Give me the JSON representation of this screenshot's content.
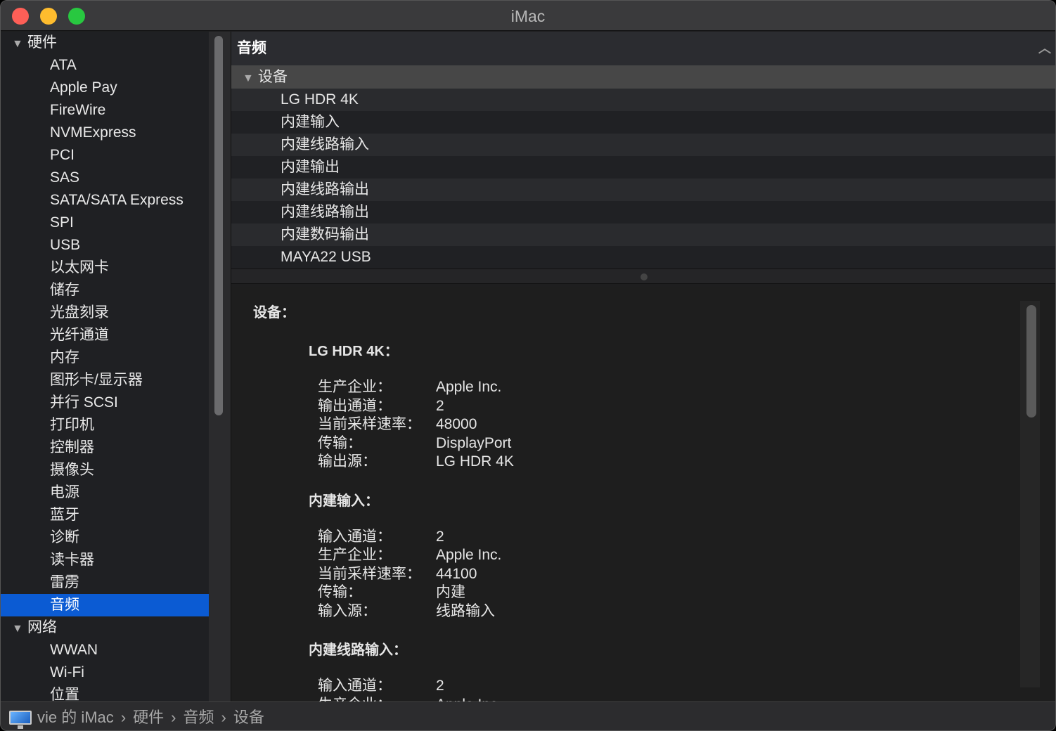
{
  "window": {
    "title": "iMac"
  },
  "sidebar": {
    "groups": [
      {
        "label": "硬件",
        "items": [
          "ATA",
          "Apple Pay",
          "FireWire",
          "NVMExpress",
          "PCI",
          "SAS",
          "SATA/SATA Express",
          "SPI",
          "USB",
          "以太网卡",
          "储存",
          "光盘刻录",
          "光纤通道",
          "内存",
          "图形卡/显示器",
          "并行 SCSI",
          "打印机",
          "控制器",
          "摄像头",
          "电源",
          "蓝牙",
          "诊断",
          "读卡器",
          "雷雳",
          "音频"
        ]
      },
      {
        "label": "网络",
        "items": [
          "WWAN",
          "Wi-Fi",
          "位置"
        ]
      }
    ],
    "selected": "音频"
  },
  "list": {
    "header": "音频",
    "group": "设备",
    "rows": [
      "LG HDR 4K",
      "内建输入",
      "内建线路输入",
      "内建输出",
      "内建线路输出",
      "内建线路输出",
      "内建数码输出",
      "MAYA22 USB"
    ]
  },
  "detail": {
    "title": "设备：",
    "devices": [
      {
        "name": "LG HDR 4K：",
        "props": [
          [
            "生产企业：",
            "Apple Inc."
          ],
          [
            "输出通道：",
            "2"
          ],
          [
            "当前采样速率：",
            "48000"
          ],
          [
            "传输：",
            "DisplayPort"
          ],
          [
            "输出源：",
            "LG HDR 4K"
          ]
        ]
      },
      {
        "name": "内建输入：",
        "props": [
          [
            "输入通道：",
            "2"
          ],
          [
            "生产企业：",
            "Apple Inc."
          ],
          [
            "当前采样速率：",
            "44100"
          ],
          [
            "传输：",
            "内建"
          ],
          [
            "输入源：",
            "线路输入"
          ]
        ]
      },
      {
        "name": "内建线路输入：",
        "props": [
          [
            "输入通道：",
            "2"
          ],
          [
            "生产企业：",
            "Apple Inc."
          ]
        ]
      }
    ]
  },
  "breadcrumb": [
    "vie 的 iMac",
    "硬件",
    "音频",
    "设备"
  ]
}
